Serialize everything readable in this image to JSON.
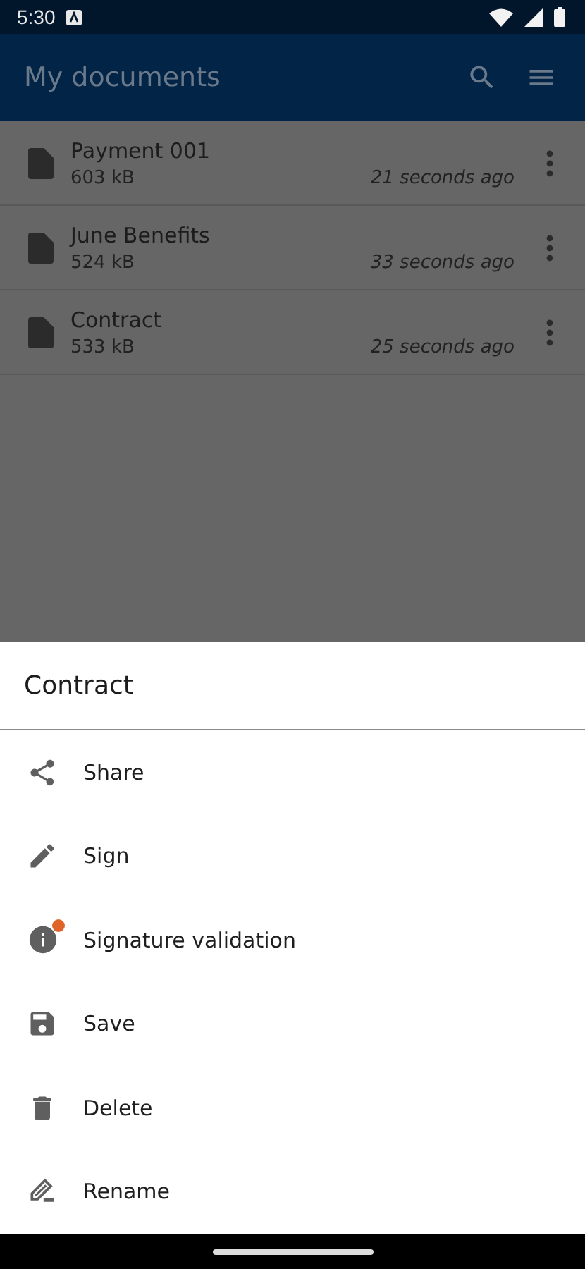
{
  "status_bar": {
    "time": "5:30"
  },
  "app_bar": {
    "title": "My documents"
  },
  "documents": [
    {
      "name": "Payment 001",
      "size": "603 kB",
      "modified": "21 seconds ago"
    },
    {
      "name": "June Benefits",
      "size": "524 kB",
      "modified": "33 seconds ago"
    },
    {
      "name": "Contract",
      "size": "533 kB",
      "modified": "25 seconds ago"
    }
  ],
  "bottom_sheet": {
    "title": "Contract",
    "items": [
      {
        "label": "Share",
        "badge": false
      },
      {
        "label": "Sign",
        "badge": false
      },
      {
        "label": "Signature validation",
        "badge": true
      },
      {
        "label": "Save",
        "badge": false
      },
      {
        "label": "Delete",
        "badge": false
      },
      {
        "label": "Rename",
        "badge": false
      }
    ]
  }
}
